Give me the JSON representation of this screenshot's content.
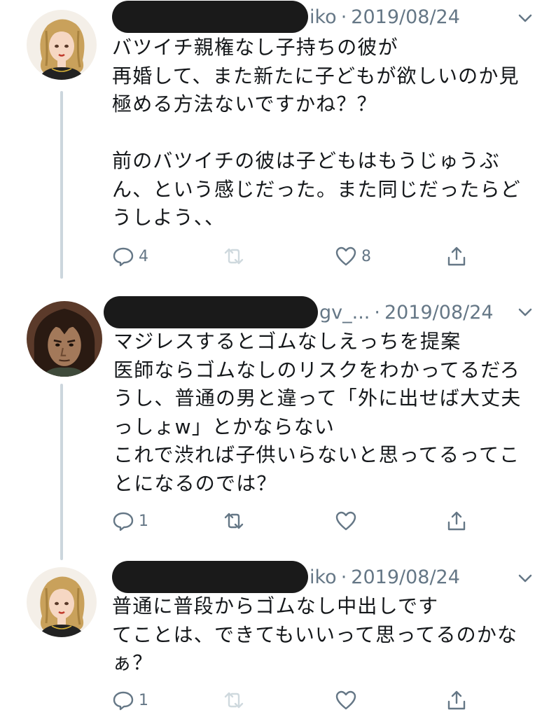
{
  "tweets": [
    {
      "handle_fragment": "iko",
      "date": "2019/08/24",
      "avatar": "blonde-woman-avatar",
      "text": "バツイチ親権なし子持ちの彼が\n再婚して、また新たに子どもが欲しいのか見\n極める方法ないですかね？？\n\n前のバツイチの彼は子どもはもうじゅうぶ\nん、という感じだった。また同じだったらど\nうしよう、、",
      "reply_count": "4",
      "retweet_count": "",
      "like_count": "8"
    },
    {
      "handle_fragment": "gv_...",
      "date": "2019/08/24",
      "avatar": "dark-haired-man-avatar",
      "text": "マジレスするとゴムなしえっちを提案\n医師ならゴムなしのリスクをわかってるだろ\nうし、普通の男と違って「外に出せば大丈夫\nっしょw」とかならない\nこれで渋れば子供いらないと思ってるってこ\nとになるのでは？",
      "reply_count": "1",
      "retweet_count": "",
      "like_count": ""
    },
    {
      "handle_fragment": "iko",
      "date": "2019/08/24",
      "avatar": "blonde-woman-avatar",
      "text": "普通に普段からゴムなし中出しです\nてことは、できてもいいって思ってるのかな\nぁ？",
      "reply_count": "1",
      "retweet_count": "",
      "like_count": ""
    }
  ],
  "separator": "·",
  "icons": {
    "reply": "reply-icon",
    "retweet": "retweet-icon",
    "like": "heart-icon",
    "share": "share-icon",
    "menu": "chevron-down-icon"
  },
  "colors": {
    "text": "#14171a",
    "muted": "#657786",
    "thread_line": "#ccd6dd",
    "redaction": "#1a1a1a"
  }
}
